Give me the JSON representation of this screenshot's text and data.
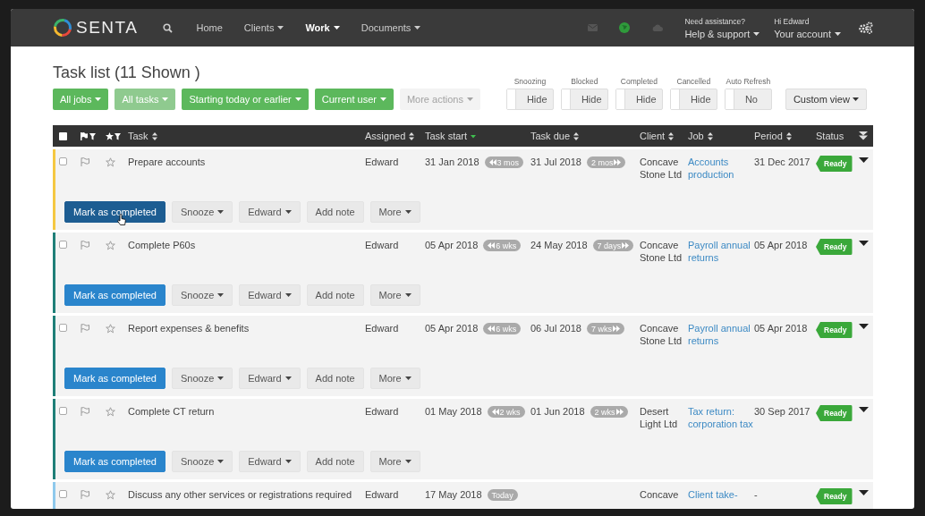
{
  "navbar": {
    "brand": "SENTA",
    "items": [
      {
        "label": "Home",
        "dropdown": false,
        "selected": false
      },
      {
        "label": "Clients",
        "dropdown": true,
        "selected": false
      },
      {
        "label": "Work",
        "dropdown": true,
        "selected": true
      },
      {
        "label": "Documents",
        "dropdown": true,
        "selected": false
      }
    ],
    "help": {
      "hint": "Need assistance?",
      "label": "Help & support"
    },
    "account": {
      "hint": "Hi Edward",
      "label": "Your account"
    }
  },
  "page": {
    "title": "Task list (11 Shown )",
    "filters": [
      {
        "label": "All jobs",
        "kind": "filter",
        "disabled": false
      },
      {
        "label": "All tasks",
        "kind": "filter",
        "disabled": true
      },
      {
        "label": "Starting today or earlier",
        "kind": "filter",
        "disabled": false
      },
      {
        "label": "Current user",
        "kind": "filter",
        "disabled": false
      },
      {
        "label": "More actions",
        "kind": "action",
        "disabled": true
      }
    ],
    "toggles": [
      {
        "label": "Snoozing",
        "value": "Hide",
        "on": false
      },
      {
        "label": "Blocked",
        "value": "Hide",
        "on": false
      },
      {
        "label": "Completed",
        "value": "Hide",
        "on": false
      },
      {
        "label": "Cancelled",
        "value": "Hide",
        "on": false
      },
      {
        "label": "Auto Refresh",
        "value": "No",
        "on": false
      }
    ],
    "custom_view": "Custom view"
  },
  "table": {
    "columns": [
      {
        "label": "Task",
        "sortable": true,
        "sorted": false
      },
      {
        "label": "Assigned",
        "sortable": true,
        "sorted": false
      },
      {
        "label": "Task start",
        "sortable": true,
        "sorted": true
      },
      {
        "label": "Task due",
        "sortable": true,
        "sorted": false
      },
      {
        "label": "Client",
        "sortable": true,
        "sorted": false
      },
      {
        "label": "Job",
        "sortable": true,
        "sorted": false
      },
      {
        "label": "Period",
        "sortable": true,
        "sorted": false
      },
      {
        "label": "Status",
        "sortable": false
      }
    ],
    "rows": [
      {
        "color": "#f5c842",
        "task": "Prepare accounts",
        "assigned": "Edward",
        "start": "31 Jan 2018",
        "start_badge": {
          "text": "3 mos",
          "kind": "back"
        },
        "due": "31 Jul 2018",
        "due_badge": {
          "text": "2 mos",
          "kind": "forward"
        },
        "client": "Concave Stone Ltd",
        "job": "Accounts production",
        "period": "31 Dec 2017",
        "status": "Ready",
        "actions": [
          {
            "label": "Mark as completed",
            "kind": "primary",
            "hovered": true
          },
          {
            "label": "Snooze",
            "kind": "dropdown",
            "hovered": false
          },
          {
            "label": "Edward",
            "kind": "dropdown",
            "hovered": false
          },
          {
            "label": "Add note",
            "kind": "plain",
            "hovered": false
          },
          {
            "label": "More",
            "kind": "dropdown",
            "hovered": false
          }
        ]
      },
      {
        "color": "#1f7f78",
        "task": "Complete P60s",
        "assigned": "Edward",
        "start": "05 Apr 2018",
        "start_badge": {
          "text": "6 wks",
          "kind": "back"
        },
        "due": "24 May 2018",
        "due_badge": {
          "text": "7 days",
          "kind": "forward"
        },
        "client": "Concave Stone Ltd",
        "job": "Payroll annual returns",
        "period": "05 Apr 2018",
        "status": "Ready",
        "actions": [
          {
            "label": "Mark as completed",
            "kind": "primary",
            "hovered": false
          },
          {
            "label": "Snooze",
            "kind": "dropdown",
            "hovered": false
          },
          {
            "label": "Edward",
            "kind": "dropdown",
            "hovered": false
          },
          {
            "label": "Add note",
            "kind": "plain",
            "hovered": false
          },
          {
            "label": "More",
            "kind": "dropdown",
            "hovered": false
          }
        ]
      },
      {
        "color": "#1f7f78",
        "task": "Report expenses & benefits",
        "assigned": "Edward",
        "start": "05 Apr 2018",
        "start_badge": {
          "text": "6 wks",
          "kind": "back"
        },
        "due": "06 Jul 2018",
        "due_badge": {
          "text": "7 wks",
          "kind": "forward"
        },
        "client": "Concave Stone Ltd",
        "job": "Payroll annual returns",
        "period": "05 Apr 2018",
        "status": "Ready",
        "actions": [
          {
            "label": "Mark as completed",
            "kind": "primary",
            "hovered": false
          },
          {
            "label": "Snooze",
            "kind": "dropdown",
            "hovered": false
          },
          {
            "label": "Edward",
            "kind": "dropdown",
            "hovered": false
          },
          {
            "label": "Add note",
            "kind": "plain",
            "hovered": false
          },
          {
            "label": "More",
            "kind": "dropdown",
            "hovered": false
          }
        ]
      },
      {
        "color": "#1f7f78",
        "task": "Complete CT return",
        "assigned": "Edward",
        "start": "01 May 2018",
        "start_badge": {
          "text": "2 wks",
          "kind": "back"
        },
        "due": "01 Jun 2018",
        "due_badge": {
          "text": "2 wks",
          "kind": "forward"
        },
        "client": "Desert Light Ltd",
        "job": "Tax return: corporation tax",
        "period": "30 Sep 2017",
        "status": "Ready",
        "actions": [
          {
            "label": "Mark as completed",
            "kind": "primary",
            "hovered": false
          },
          {
            "label": "Snooze",
            "kind": "dropdown",
            "hovered": false
          },
          {
            "label": "Edward",
            "kind": "dropdown",
            "hovered": false
          },
          {
            "label": "Add note",
            "kind": "plain",
            "hovered": false
          },
          {
            "label": "More",
            "kind": "dropdown",
            "hovered": false
          }
        ]
      },
      {
        "color": "#8ec9ec",
        "task": "Discuss any other services or registrations required",
        "assigned": "Edward",
        "start": "17 May 2018",
        "start_badge": {
          "text": "Today",
          "kind": "plain"
        },
        "client": "Concave",
        "job": "Client take-",
        "period": "-",
        "status": "Ready"
      }
    ]
  }
}
